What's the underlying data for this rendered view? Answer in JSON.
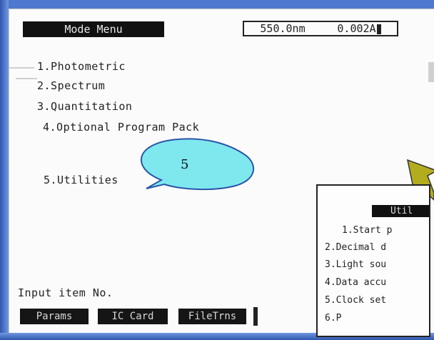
{
  "mode_menu": {
    "title": "Mode Menu",
    "items": [
      "1.Photometric",
      "2.Spectrum",
      "3.Quantitation",
      "4.Optional Program Pack",
      "5.Utilities"
    ]
  },
  "status": {
    "wavelength": "550.0nm",
    "absorbance": "0.002A"
  },
  "prompt": "Input item No.",
  "softkeys": [
    "Params",
    "IC Card",
    "FileTrns"
  ],
  "callout": {
    "label": "5"
  },
  "utilities_menu": {
    "title": "Util",
    "items": [
      "1.Start p",
      "2.Decimal d",
      "3.Light sou",
      "4.Data accu",
      "5.Clock set",
      "6.P"
    ]
  },
  "colors": {
    "slide_background": "#4f79cf",
    "screen_background": "#fbfbfb",
    "title_bar": "#111111",
    "callout_fill": "#7fe8ef",
    "arrow_fill": "#b3ad1e"
  }
}
